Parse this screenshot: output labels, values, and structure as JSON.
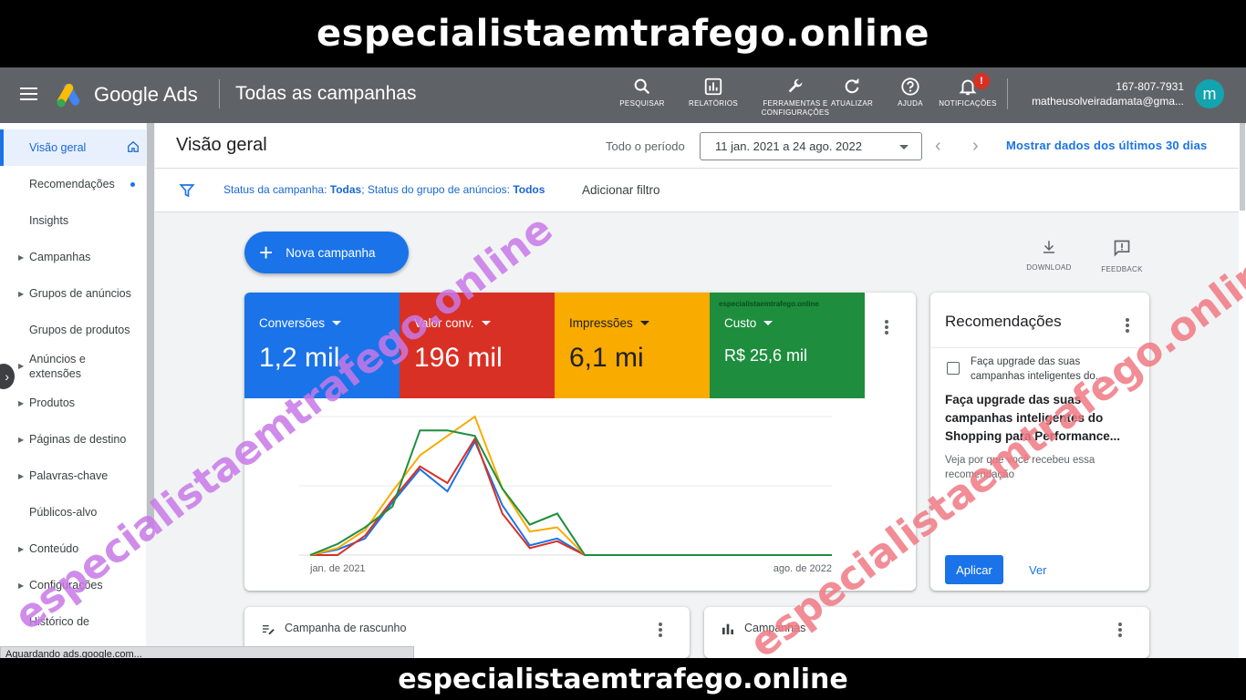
{
  "banner": {
    "top_text": "especialistaemtrafego.online",
    "bottom_text": "especialistaemtrafego.online"
  },
  "appbar": {
    "product_name": "Google Ads",
    "page_scope": "Todas as campanhas",
    "tools": [
      {
        "label": "PESQUISAR",
        "icon": "search-icon"
      },
      {
        "label": "RELATÓRIOS",
        "icon": "reports-icon"
      },
      {
        "label": "FERRAMENTAS E CONFIGURAÇÕES",
        "icon": "wrench-icon"
      },
      {
        "label": "ATUALIZAR",
        "icon": "refresh-icon"
      },
      {
        "label": "AJUDA",
        "icon": "help-icon"
      },
      {
        "label": "NOTIFICAÇÕES",
        "icon": "bell-icon",
        "badge": "!"
      }
    ],
    "account_id": "167-807-7931",
    "account_email": "matheusolveiradamata@gma...",
    "avatar_letter": "m"
  },
  "sidebar": {
    "items": [
      {
        "label": "Visão geral",
        "active": true
      },
      {
        "label": "Recomendações",
        "dot": true
      },
      {
        "label": "Insights"
      },
      {
        "label": "Campanhas",
        "caret": true
      },
      {
        "label": "Grupos de anúncios",
        "caret": true
      },
      {
        "label": "Grupos de produtos"
      },
      {
        "label": "Anúncios e extensões",
        "caret": true
      },
      {
        "label": "Produtos",
        "caret": true
      },
      {
        "label": "Páginas de destino",
        "caret": true
      },
      {
        "label": "Palavras-chave",
        "caret": true
      },
      {
        "label": "Públicos-alvo"
      },
      {
        "label": "Conteúdo",
        "caret": true
      },
      {
        "label": "Configurações",
        "caret": true
      },
      {
        "label": "Histórico de"
      }
    ]
  },
  "status_bar": "Aguardando ads.google.com...",
  "header": {
    "title": "Visão geral",
    "period_label": "Todo o período",
    "date_range": "11 jan. 2021 a 24 ago. 2022",
    "last30": "Mostrar dados dos últimos 30 dias"
  },
  "filter": {
    "prefix1": "Status da campanha: ",
    "value1": "Todas",
    "prefix2": "; Status do grupo de anúncios: ",
    "value2": "Todos",
    "add_filter": "Adicionar filtro"
  },
  "fab": {
    "label": "Nova campanha"
  },
  "mini_tools": [
    {
      "label": "DOWNLOAD",
      "icon": "download-icon"
    },
    {
      "label": "FEEDBACK",
      "icon": "feedback-icon"
    }
  ],
  "metrics": [
    {
      "label": "Conversões",
      "value": "1,2 mil",
      "color": "#1a73e8"
    },
    {
      "label": "Valor conv.",
      "value": "196 mil",
      "color": "#d93025"
    },
    {
      "label": "Impressões",
      "value": "6,1 mi",
      "color": "#f9ab00"
    },
    {
      "label": "Custo",
      "value": "R$ 25,6 mil",
      "color": "#1e8e3e"
    }
  ],
  "metric_tile_watermark": "especialistaemtrafego.online",
  "chart_data": {
    "type": "line",
    "x_start_label": "jan. de 2021",
    "x_end_label": "ago. de 2022",
    "grid": true,
    "series": [
      {
        "name": "Conversões",
        "color": "#1a73e8",
        "values": [
          0,
          4,
          12,
          38,
          62,
          46,
          82,
          36,
          7,
          12,
          0,
          0,
          0,
          0,
          0,
          0,
          0,
          0,
          0,
          0
        ]
      },
      {
        "name": "Valor conv.",
        "color": "#d93025",
        "values": [
          0,
          0,
          14,
          40,
          64,
          52,
          84,
          30,
          5,
          10,
          0,
          0,
          0,
          0,
          0,
          0,
          0,
          0,
          0,
          0
        ]
      },
      {
        "name": "Impressões",
        "color": "#f9ab00",
        "values": [
          0,
          5,
          18,
          46,
          72,
          86,
          100,
          48,
          17,
          20,
          0,
          0,
          0,
          0,
          0,
          0,
          0,
          0,
          0,
          0
        ]
      },
      {
        "name": "Custo",
        "color": "#1e8e3e",
        "values": [
          0,
          8,
          20,
          35,
          90,
          90,
          86,
          48,
          22,
          30,
          0,
          0,
          0,
          0,
          0,
          0,
          0,
          0,
          0,
          0
        ]
      }
    ],
    "ylim": [
      0,
      100
    ]
  },
  "recommendations": {
    "title": "Recomendações",
    "subtitle": "Faça upgrade das suas campanhas inteligentes do...",
    "headline": "Faça upgrade das suas campanhas inteligentes do Shopping para Performance...",
    "why": "Veja por que você recebeu essa recomendação",
    "apply": "Aplicar",
    "view": "Ver"
  },
  "cards": {
    "draft": "Campanha de rascunho",
    "campaigns": "Campanhas"
  },
  "watermark": "especialistaemtrafego.online"
}
